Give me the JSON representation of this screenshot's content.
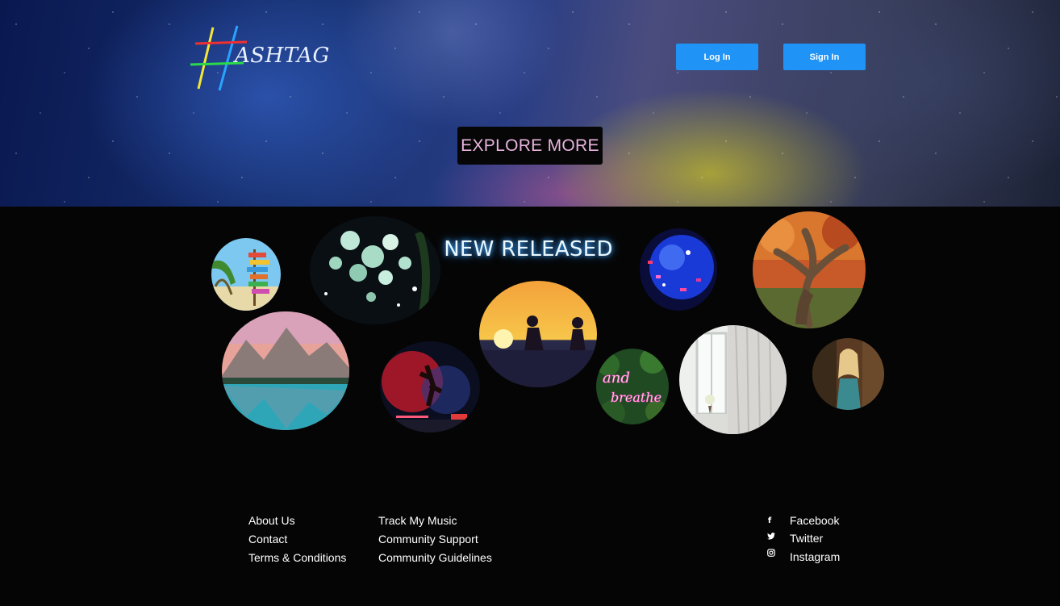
{
  "header": {
    "logo_text": "ASHTAG",
    "login_label": "Log In",
    "signin_label": "Sign In"
  },
  "hero": {
    "explore_label": "EXPLORE MORE"
  },
  "releases": {
    "title": "NEW RELEASED",
    "items": [
      {
        "name": "signpost-beach"
      },
      {
        "name": "disco-balls-night"
      },
      {
        "name": "blue-disco-ball"
      },
      {
        "name": "twisted-tree"
      },
      {
        "name": "mountain-lake"
      },
      {
        "name": "dancer-stage"
      },
      {
        "name": "sunset-couple-guitar"
      },
      {
        "name": "and-breathe-neon"
      },
      {
        "name": "window-curtain"
      },
      {
        "name": "woman-portrait"
      }
    ]
  },
  "footer": {
    "col1": [
      "About Us",
      "Contact",
      "Terms & Conditions"
    ],
    "col2": [
      "Track My Music",
      "Community Support",
      "Community Guidelines"
    ],
    "social": [
      {
        "label": "Facebook",
        "icon": "facebook-icon"
      },
      {
        "label": "Twitter",
        "icon": "twitter-icon"
      },
      {
        "label": "Instagram",
        "icon": "instagram-icon"
      }
    ]
  },
  "colors": {
    "accent": "#1f93f6",
    "explore_text": "#e8b4de",
    "background": "#050505"
  }
}
